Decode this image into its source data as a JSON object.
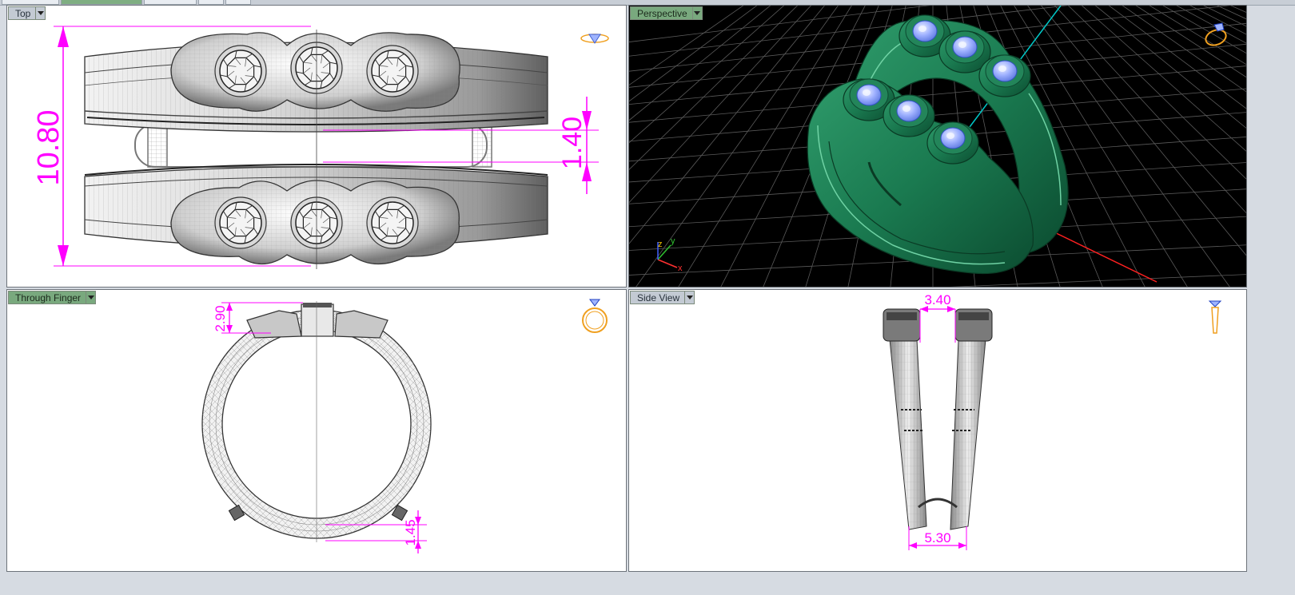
{
  "viewports": {
    "top": {
      "label": "Top",
      "active": false
    },
    "perspective": {
      "label": "Perspective",
      "active": true
    },
    "through_finger": {
      "label": "Through Finger",
      "active": true
    },
    "side": {
      "label": "Side View",
      "active": false
    }
  },
  "dimensions": {
    "top_height": "10.80",
    "top_gap": "1.40",
    "finger_height": "2.90",
    "finger_band": "1.45",
    "side_top": "3.40",
    "side_bottom": "5.30"
  },
  "axes": {
    "x": "x",
    "y": "y",
    "z": "z"
  },
  "colors": {
    "dimension": "#ff00ff",
    "model_green": "#1f7a55",
    "stone_blue": "#8fa6ff",
    "axis_x": "#ff2020",
    "axis_y": "#00c8c8",
    "viewcube": "#f0a020",
    "active_label": "#79a97e",
    "inactive_label": "#c3cad3"
  }
}
